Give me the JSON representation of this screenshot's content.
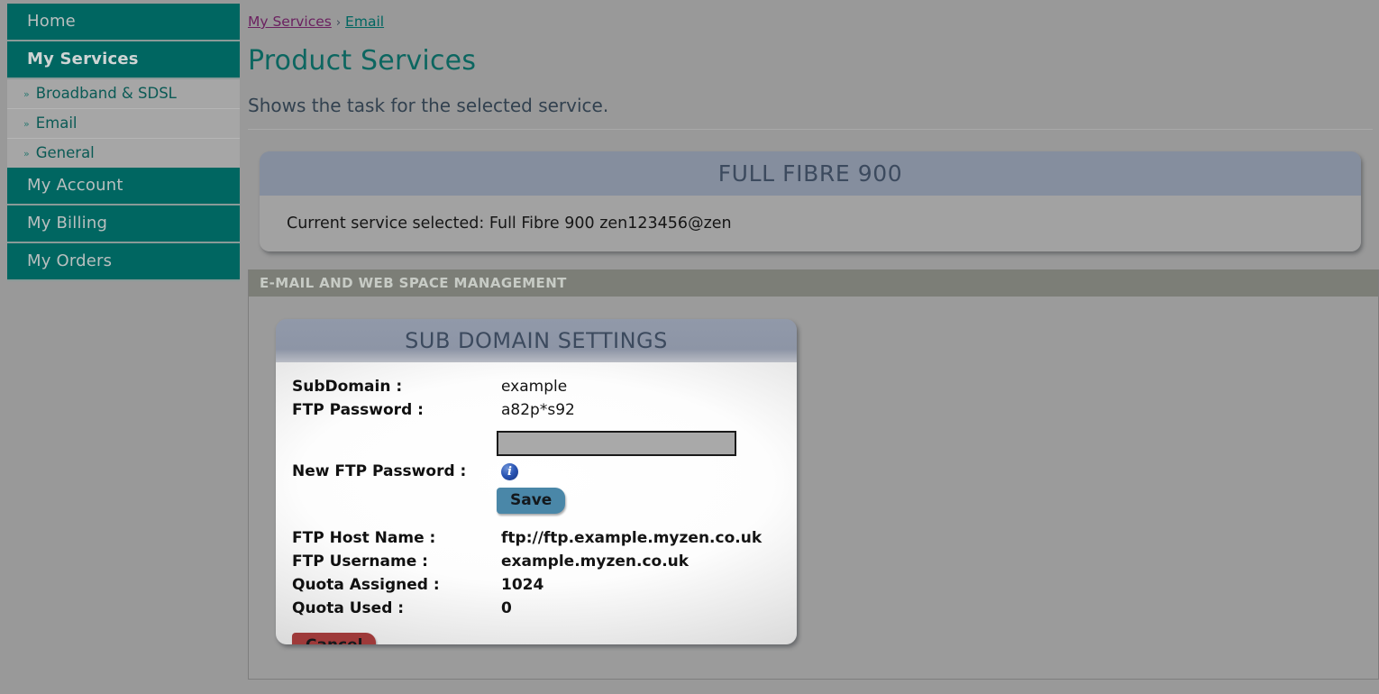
{
  "sidebar": {
    "items": [
      {
        "label": "Home",
        "active": false
      },
      {
        "label": "My Services",
        "active": true
      },
      {
        "label": "My Account",
        "active": false
      },
      {
        "label": "My Billing",
        "active": false
      },
      {
        "label": "My Orders",
        "active": false
      }
    ],
    "submenu": [
      {
        "label": "Broadband & SDSL"
      },
      {
        "label": "Email"
      },
      {
        "label": "General"
      }
    ],
    "chevron_glyph": "»"
  },
  "breadcrumb": {
    "first": "My Services",
    "separator": "›",
    "second": "Email"
  },
  "page": {
    "title": "Product Services",
    "subtitle": "Shows the task for the selected service."
  },
  "service_panel": {
    "title": "FULL FIBRE 900",
    "current_service": "Current service selected: Full Fibre 900 zen123456@zen"
  },
  "section": {
    "heading": "E-MAIL AND WEB SPACE MANAGEMENT"
  },
  "card": {
    "title": "SUB DOMAIN SETTINGS",
    "fields": {
      "subdomain_label": "SubDomain :",
      "subdomain_value": "example",
      "ftp_password_label": "FTP Password :",
      "ftp_password_value": "a82p*s92",
      "new_ftp_password_label": "New FTP Password :",
      "new_ftp_password_value": "",
      "ftp_host_label": "FTP Host Name :",
      "ftp_host_value": "ftp://ftp.example.myzen.co.uk",
      "ftp_username_label": "FTP Username :",
      "ftp_username_value": "example.myzen.co.uk",
      "quota_assigned_label": "Quota Assigned :",
      "quota_assigned_value": "1024",
      "quota_used_label": "Quota Used :",
      "quota_used_value": "0"
    },
    "buttons": {
      "save": "Save",
      "cancel": "Cancel"
    },
    "icons": {
      "collapse": "minus-icon",
      "info": "i"
    }
  },
  "colors": {
    "page_background": "#999999",
    "nav_teal": "#006661",
    "submenu_gray": "#a6a6a6",
    "title_teal": "#0c6660",
    "panel_head_slate": "#858e9e",
    "section_head": "#7c7e77",
    "save_blue": "#4a87a8",
    "cancel_red": "#9e3a3a",
    "info_blue": "#2a55b4",
    "link_visited": "#6b2160"
  }
}
